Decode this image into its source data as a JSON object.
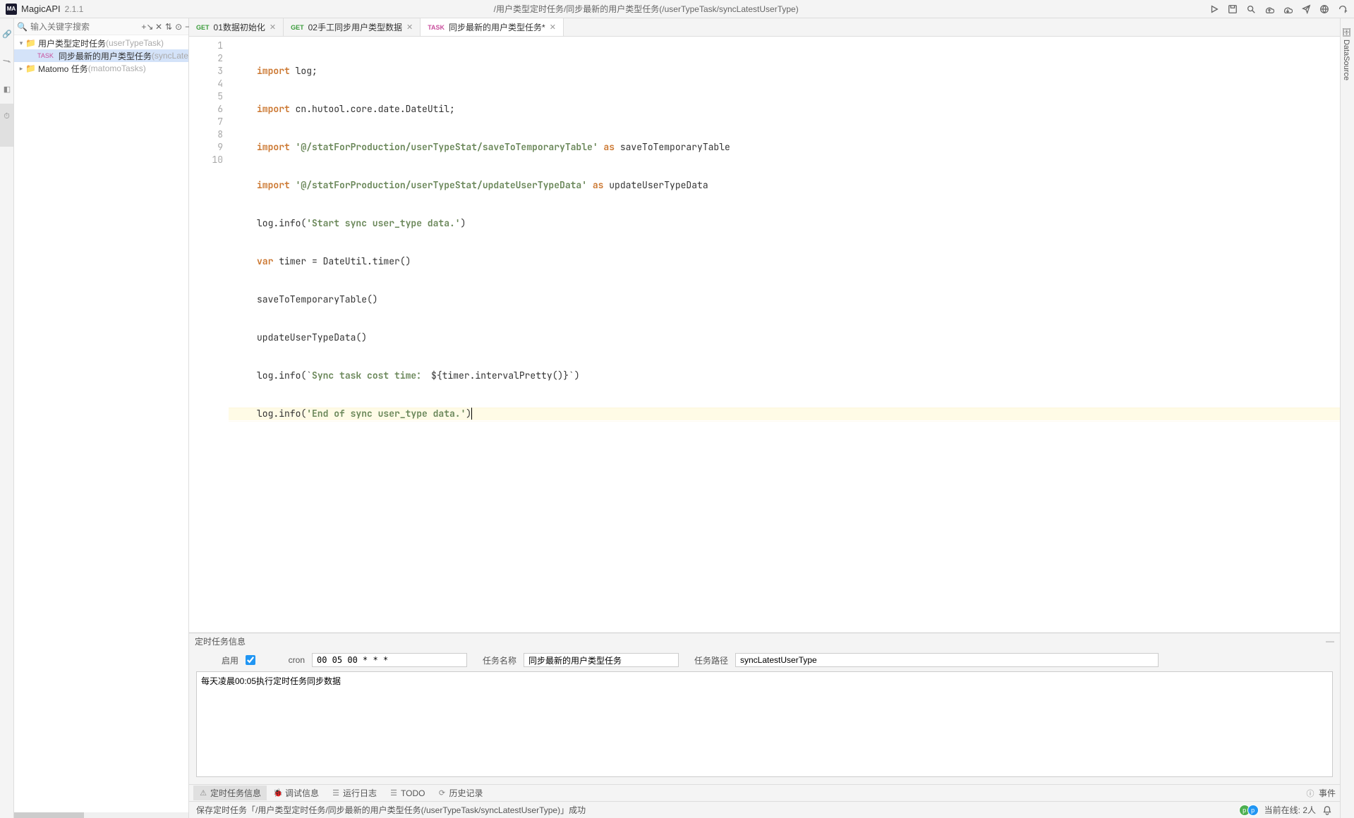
{
  "header": {
    "app_name": "MagicAPI",
    "version": "2.1.1",
    "breadcrumb": "/用户类型定时任务/同步最新的用户类型任务(/userTypeTask/syncLatestUserType)"
  },
  "left_vtabs": {
    "t0": "接口",
    "t1": "函数",
    "t2": "组件",
    "t3": "定时任务"
  },
  "sidebar": {
    "search_placeholder": "输入关键字搜索",
    "row0_label": "用户类型定时任务",
    "row0_paren": "(userTypeTask)",
    "row1_badge": "TASK",
    "row1_label": "同步最新的用户类型任务",
    "row1_paren": "(syncLatestU",
    "row2_label": "Matomo 任务",
    "row2_paren": "(matomoTasks)"
  },
  "tabs": {
    "t0_method": "GET",
    "t0_label": "01数据初始化",
    "t1_method": "GET",
    "t1_label": "02手工同步用户类型数据",
    "t2_method": "TASK",
    "t2_label": "同步最新的用户类型任务*"
  },
  "info_panel": {
    "title": "定时任务信息",
    "enable_label": "启用",
    "cron_label": "cron",
    "cron_value": "00 05 00 * * *",
    "name_label": "任务名称",
    "name_value": "同步最新的用户类型任务",
    "path_label": "任务路径",
    "path_value": "syncLatestUserType",
    "desc_value": "每天凌晨00:05执行定时任务同步数据"
  },
  "bottom_tabs": {
    "b0": "定时任务信息",
    "b1": "调试信息",
    "b2": "运行日志",
    "b3": "TODO",
    "b4": "历史记录",
    "event": "事件"
  },
  "status": {
    "message": "保存定时任务「/用户类型定时任务/同步最新的用户类型任务(/userTypeTask/syncLatestUserType)」成功",
    "online_label": "当前在线: 2人"
  },
  "right_vtabs": {
    "r0": "DataSource"
  },
  "code": {
    "l1_kw": "import",
    "l1_rest": " log;",
    "l2_kw": "import",
    "l2_rest": " cn.hutool.core.date.DateUtil;",
    "l3_kw1": "import",
    "l3_str": " '@/statForProduction/userTypeStat/saveToTemporaryTable'",
    "l3_kw2": " as",
    "l3_rest": " saveToTemporaryTable",
    "l4_kw1": "import",
    "l4_str": " '@/statForProduction/userTypeStat/updateUserTypeData'",
    "l4_kw2": " as",
    "l4_rest": " updateUserTypeData",
    "l5_a": "log.info(",
    "l5_str": "'Start sync user_type data.'",
    "l5_b": ")",
    "l6_kw": "var",
    "l6_rest": " timer = DateUtil.timer()",
    "l7": "saveToTemporaryTable()",
    "l8": "updateUserTypeData()",
    "l9_a": "log.info(`",
    "l9_str": "Sync task cost time：",
    "l9_b": " ${timer.intervalPretty()}`)",
    "l10_a": "log.info(",
    "l10_str": "'End of sync user_type data.'",
    "l10_b": ")"
  },
  "line_numbers": [
    "1",
    "2",
    "3",
    "4",
    "5",
    "6",
    "7",
    "8",
    "9",
    "10"
  ]
}
